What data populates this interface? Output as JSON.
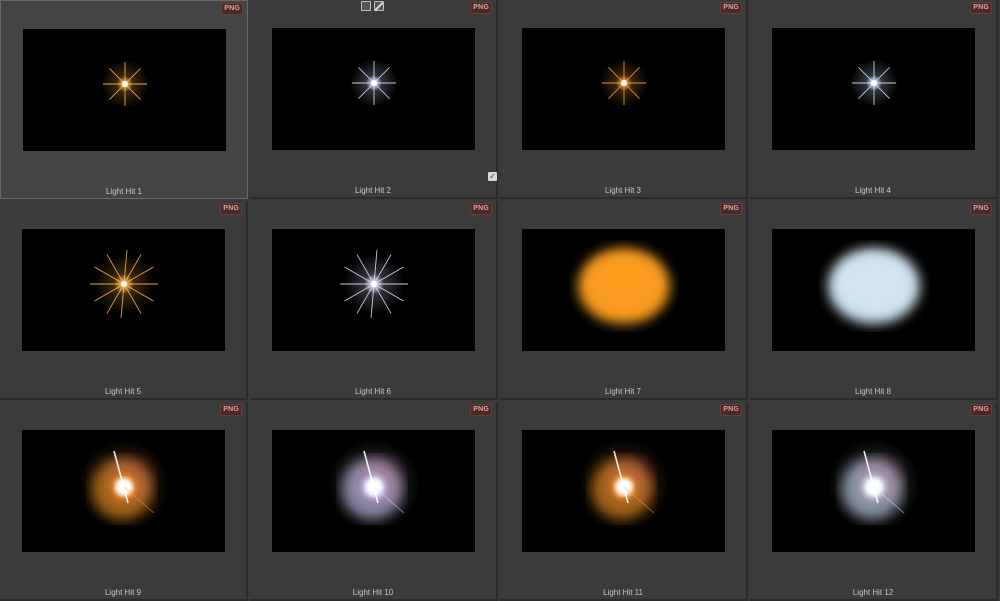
{
  "toolbar": {
    "icons": [
      "square-select-icon",
      "pencil-edit-icon"
    ]
  },
  "items": [
    {
      "label": "Light Hit 1",
      "badge": "PNG",
      "color": "#ffb24a",
      "style": "star-small",
      "selected": true
    },
    {
      "label": "Light Hit 2",
      "badge": "PNG",
      "color": "#d8dcff",
      "style": "star-small",
      "checked": true
    },
    {
      "label": "Light Hit 3",
      "badge": "PNG",
      "color": "#ffa030",
      "style": "star-small"
    },
    {
      "label": "Light Hit 4",
      "badge": "PNG",
      "color": "#cfe6ff",
      "style": "star-small"
    },
    {
      "label": "Light Hit 5",
      "badge": "PNG",
      "color": "#ffb24a",
      "style": "star-large"
    },
    {
      "label": "Light Hit 6",
      "badge": "PNG",
      "color": "#e6dcff",
      "style": "star-large"
    },
    {
      "label": "Light Hit 7",
      "badge": "PNG",
      "color": "#ffa020",
      "style": "blob"
    },
    {
      "label": "Light Hit 8",
      "badge": "PNG",
      "color": "#d6eaf6",
      "style": "blob"
    },
    {
      "label": "Light Hit 9",
      "badge": "PNG",
      "color": "#ff9a2a",
      "style": "flare"
    },
    {
      "label": "Light Hit 10",
      "badge": "PNG",
      "color": "#d8d4ff",
      "style": "flare"
    },
    {
      "label": "Light Hit 11",
      "badge": "PNG",
      "color": "#ff9a2a",
      "style": "flare"
    },
    {
      "label": "Light Hit 12",
      "badge": "PNG",
      "color": "#d6e8ff",
      "style": "flare"
    }
  ]
}
